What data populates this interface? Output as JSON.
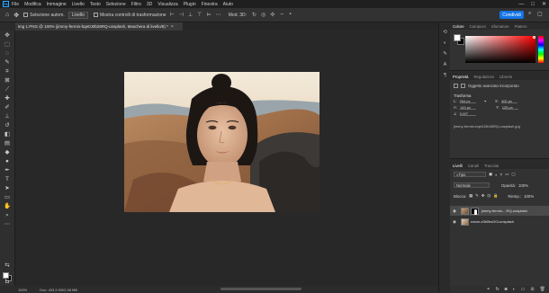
{
  "menubar": {
    "logo": "Ps",
    "items": [
      "File",
      "Modifica",
      "Immagine",
      "Livello",
      "Testo",
      "Selezione",
      "Filtro",
      "3D",
      "Visualizza",
      "Plugin",
      "Finestra",
      "Aiuto"
    ],
    "window_controls": [
      "—",
      "□",
      "✕"
    ]
  },
  "options": {
    "auto_select_label": "Selezione autom.",
    "target_select": "Livello",
    "show_transform_label": "Mostra controlli di trasformazione",
    "mode3d_label": "Mod. 3D:",
    "share_label": "Condividi"
  },
  "document": {
    "tab_title": "img 1.PNG @ 100% (jimmy-fermin-bqe0J0b26RQ-unsplash, Maschera di livello/8) *",
    "close_glyph": "×"
  },
  "status": {
    "zoom": "100%",
    "doc_info": "Doc: 433,9 KB/2,98 MB"
  },
  "color_panel": {
    "tabs": [
      "Colore",
      "Campioni",
      "Sfumature",
      "Pattern"
    ],
    "active_tab": "Colore",
    "foreground": "#ffffff",
    "background": "#000000"
  },
  "properties_panel": {
    "tabs": [
      "Proprietà",
      "Regolazioni",
      "Librerie"
    ],
    "active_tab": "Proprietà",
    "object_type": "Oggetto avanzato incorporato",
    "transform_title": "Trasforma",
    "w_label": "L:",
    "w_value": "264 px",
    "x_label": "X:",
    "x_value": "400 px",
    "h_label": "A:",
    "h_value": "143 px",
    "y_label": "Y:",
    "y_value": "125 px",
    "angle_value": "0,00°",
    "file_name": "jimmy-fermin-bqe0J0b26RQ-unsplash.jpg"
  },
  "layers_panel": {
    "tabs": [
      "Livelli",
      "Canali",
      "Tracciati"
    ],
    "active_tab": "Livelli",
    "filter_label": "Tipo",
    "blend_mode": "Normale",
    "opacity_label": "Opacità:",
    "opacity_value": "100%",
    "lock_label": "Blocca:",
    "fill_label": "Riemp.:",
    "fill_value": "100%",
    "layers": [
      {
        "name": "jimmy-fermin-...RQ-unsplash",
        "selected": true,
        "has_mask": true
      },
      {
        "name": "naom-z3b0hsG0I-unsplash",
        "selected": false,
        "has_mask": false
      }
    ],
    "bottom_icons": [
      "link-icon",
      "fx-icon",
      "mask-icon",
      "adjustment-icon",
      "folder-icon",
      "new-layer-icon",
      "trash-icon"
    ]
  },
  "colors": {
    "accent": "#1473e6",
    "panel": "#323232",
    "canvas": "#282828"
  }
}
